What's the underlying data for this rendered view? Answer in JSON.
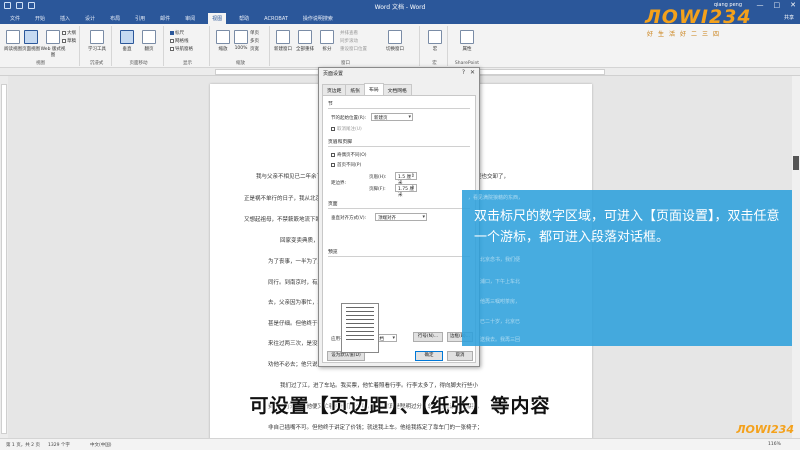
{
  "window": {
    "title": "Word 文档 - Word",
    "user": "qiang peng",
    "share": "共享",
    "controls": [
      "—",
      "□",
      "✕"
    ]
  },
  "tabs": [
    "文件",
    "开始",
    "插入",
    "设计",
    "布局",
    "引用",
    "邮件",
    "审阅",
    "视图",
    "帮助",
    "ACROBAT",
    "操作说明搜索"
  ],
  "active_tab": "视图",
  "ribbon": {
    "views": {
      "read_mode": "阅读视图",
      "print_layout": "页面视图",
      "web_layout": "Web 版式视图",
      "outline": "大纲",
      "draft": "草稿",
      "group": "视图"
    },
    "immersive": {
      "learning": "学习工具",
      "group": "沉浸式"
    },
    "page_movement": {
      "vertical": "垂直",
      "side": "翻页",
      "group": "页面移动"
    },
    "show": {
      "ruler": "标尺",
      "gridlines": "网格线",
      "nav_pane": "导航窗格",
      "group": "显示"
    },
    "zoom": {
      "zoom": "缩放",
      "percent": "100%",
      "one_page": "单页",
      "multi_page": "多页",
      "page_width": "页宽",
      "group": "缩放"
    },
    "window": {
      "new_window": "新建窗口",
      "arrange_all": "全部重排",
      "split": "拆分",
      "side_by_side": "并排查看",
      "sync": "同步滚动",
      "reset": "重设窗口位置",
      "switch": "切换窗口",
      "group": "窗口"
    },
    "macros": {
      "label": "宏",
      "group": "宏"
    },
    "sharepoint": {
      "label": "属性",
      "group": "SharePoint"
    }
  },
  "logo": {
    "text": "ЛOWI234",
    "sub": "好生活好二三四"
  },
  "document": {
    "lines": [
      "我与父亲不相见已二年余了，我最不能忘记的是他的背影。那年冬天，祖母死了，父亲的差使也交卸了，",
      "正是祸不单行的日子，我从北京到徐州，打算跟着父亲奔丧回家。",
      "又想起祖母，不禁簌簌地流下眼泪。",
      "回家变卖典质，父亲还了亏空；",
      "为了丧事，一半为了父亲赋闲。",
      "同行。到南京时，有朋友约去游逛，",
      "去，父亲因为事忙，本已说定不送我，",
      "甚是仔细。但他终于不放心，",
      "来往过两三次，是没有什么要紧的了。",
      "劝他不必去；他只说，“不要紧，他们去不好！”",
      "我们过了江，进了车站。我买票，他忙着照看行李。行李太多了，得向脚夫行些小",
      "费，才可过去。他便又忙着和他们讲价钱。我那时真是聪明过分，总觉他说话不大漂亮，",
      "非自己插嘴不可。但他终于讲定了价钱；就送我上车。他给我拣定了靠车门的一张椅子；"
    ]
  },
  "dialog": {
    "title": "页面设置",
    "help": "?",
    "close": "✕",
    "tabs": [
      "页边距",
      "纸张",
      "布局",
      "文档网格"
    ],
    "active_tab": "布局",
    "section_heading": "节",
    "section_start_label": "节的起始位置(R):",
    "section_start_value": "新建页",
    "suppress_endnotes": "取消尾注(U)",
    "headers_heading": "页眉和页脚",
    "odd_even": "奇偶页不同(O)",
    "first_page": "首页不同(P)",
    "from_edge_label": "距边界:",
    "header_label": "页眉(H):",
    "header_value": "1.5 厘米",
    "footer_label": "页脚(F):",
    "footer_value": "1.75 厘米",
    "page_heading": "页面",
    "valign_label": "垂直对齐方式(V):",
    "valign_value": "顶端对齐",
    "preview_heading": "预览",
    "apply_label": "应用于(Y):",
    "apply_value": "整篇文档",
    "line_numbers": "行号(N)...",
    "borders": "边框(B)...",
    "set_default": "设为默认值(D)",
    "ok": "确定",
    "cancel": "取消"
  },
  "callout": {
    "text": "双击标尺的数字区域，可进入【页面设置】，双击任意一个游标，都可进入段落对话框。",
    "faint_lines": [
      "，看见满院狼藉的东西，",
      "北京念书，我们便",
      "浦口，下午上车北",
      "他再三嘱咐茶房，",
      "已二十岁，北京已",
      "送我去。我再三回"
    ]
  },
  "subtitle": "可设置【页边距】、【纸张】等内容",
  "statusbar": {
    "page": "第 1 页，共 2 页",
    "words": "1329 个字",
    "lang": "中文(中国)",
    "zoom": "116%"
  },
  "watermark": "ЛOWI234"
}
